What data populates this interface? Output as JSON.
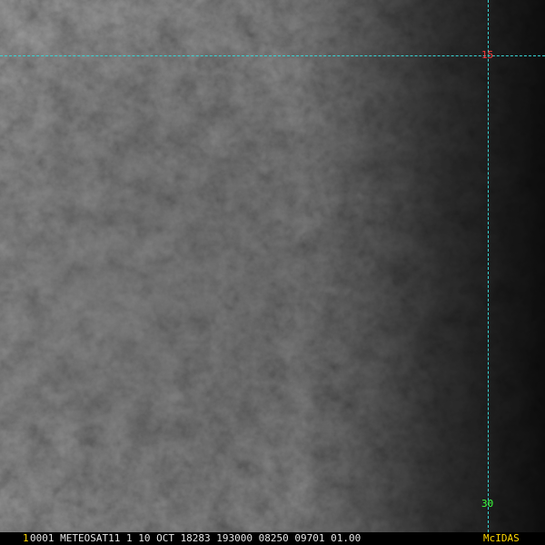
{
  "image": {
    "satellite": "METEOSAT11",
    "header_line": "0001 METEOSAT11  1 10 OCT 18283 193000 08250 09701 01.00",
    "frame_number": "1",
    "software": "McIDAS"
  },
  "grid": {
    "lat_label": "15",
    "lon_label": "30"
  },
  "colors": {
    "grid_line": "#37d6d6",
    "lat_label": "#ff3b3b",
    "lon_label": "#3bff3b",
    "frame_number": "#ffd700",
    "software": "#ffd700",
    "header_text": "#e6e6e6"
  }
}
